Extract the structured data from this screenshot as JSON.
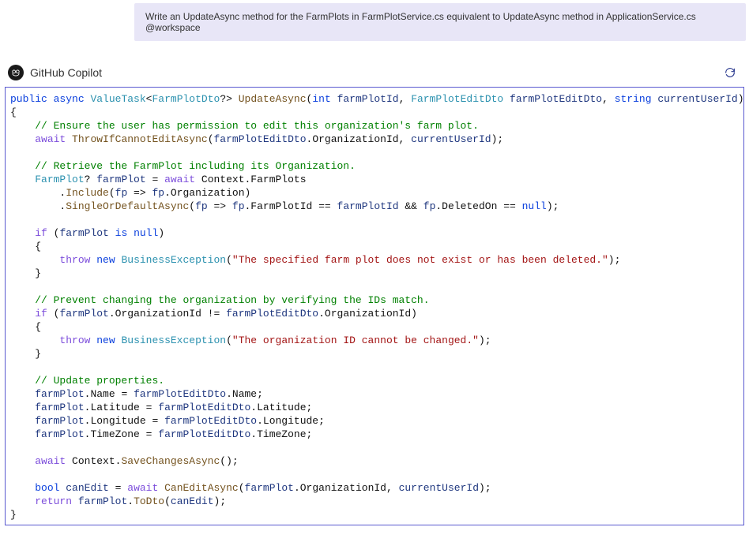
{
  "prompt": {
    "text": "Write an UpdateAsync method for the FarmPlots in FarmPlotService.cs equivalent to UpdateAsync method in ApplicationService.cs @workspace"
  },
  "chat": {
    "sender": "GitHub Copilot"
  },
  "code": {
    "tokens": [
      [
        {
          "t": "public",
          "c": "kw"
        },
        {
          "t": " "
        },
        {
          "t": "async",
          "c": "kw"
        },
        {
          "t": " "
        },
        {
          "t": "ValueTask",
          "c": "type"
        },
        {
          "t": "<"
        },
        {
          "t": "FarmPlotDto",
          "c": "type"
        },
        {
          "t": "?> "
        },
        {
          "t": "UpdateAsync",
          "c": "method"
        },
        {
          "t": "("
        },
        {
          "t": "int",
          "c": "kw"
        },
        {
          "t": " "
        },
        {
          "t": "farmPlotId",
          "c": "param"
        },
        {
          "t": ", "
        },
        {
          "t": "FarmPlotEditDto",
          "c": "type"
        },
        {
          "t": " "
        },
        {
          "t": "farmPlotEditDto",
          "c": "param"
        },
        {
          "t": ", "
        },
        {
          "t": "string",
          "c": "kw"
        },
        {
          "t": " "
        },
        {
          "t": "currentUserId",
          "c": "param"
        },
        {
          "t": ")"
        }
      ],
      [
        {
          "t": "{"
        }
      ],
      [
        {
          "t": "    "
        },
        {
          "t": "// Ensure the user has permission to edit this organization's farm plot.",
          "c": "comment"
        }
      ],
      [
        {
          "t": "    "
        },
        {
          "t": "await",
          "c": "prep"
        },
        {
          "t": " "
        },
        {
          "t": "ThrowIfCannotEditAsync",
          "c": "method"
        },
        {
          "t": "("
        },
        {
          "t": "farmPlotEditDto",
          "c": "local"
        },
        {
          "t": ".OrganizationId, "
        },
        {
          "t": "currentUserId",
          "c": "local"
        },
        {
          "t": ");"
        }
      ],
      [],
      [
        {
          "t": "    "
        },
        {
          "t": "// Retrieve the FarmPlot including its Organization.",
          "c": "comment"
        }
      ],
      [
        {
          "t": "    "
        },
        {
          "t": "FarmPlot",
          "c": "type"
        },
        {
          "t": "? "
        },
        {
          "t": "farmPlot",
          "c": "local"
        },
        {
          "t": " = "
        },
        {
          "t": "await",
          "c": "prep"
        },
        {
          "t": " Context.FarmPlots"
        }
      ],
      [
        {
          "t": "        ."
        },
        {
          "t": "Include",
          "c": "method"
        },
        {
          "t": "("
        },
        {
          "t": "fp",
          "c": "local"
        },
        {
          "t": " => "
        },
        {
          "t": "fp",
          "c": "local"
        },
        {
          "t": ".Organization)"
        }
      ],
      [
        {
          "t": "        ."
        },
        {
          "t": "SingleOrDefaultAsync",
          "c": "method"
        },
        {
          "t": "("
        },
        {
          "t": "fp",
          "c": "local"
        },
        {
          "t": " => "
        },
        {
          "t": "fp",
          "c": "local"
        },
        {
          "t": ".FarmPlotId == "
        },
        {
          "t": "farmPlotId",
          "c": "local"
        },
        {
          "t": " && "
        },
        {
          "t": "fp",
          "c": "local"
        },
        {
          "t": ".DeletedOn == "
        },
        {
          "t": "null",
          "c": "kw"
        },
        {
          "t": ");"
        }
      ],
      [],
      [
        {
          "t": "    "
        },
        {
          "t": "if",
          "c": "prep"
        },
        {
          "t": " ("
        },
        {
          "t": "farmPlot",
          "c": "local"
        },
        {
          "t": " "
        },
        {
          "t": "is",
          "c": "kw"
        },
        {
          "t": " "
        },
        {
          "t": "null",
          "c": "kw"
        },
        {
          "t": ")"
        }
      ],
      [
        {
          "t": "    {"
        }
      ],
      [
        {
          "t": "        "
        },
        {
          "t": "throw",
          "c": "prep"
        },
        {
          "t": " "
        },
        {
          "t": "new",
          "c": "kw"
        },
        {
          "t": " "
        },
        {
          "t": "BusinessException",
          "c": "type"
        },
        {
          "t": "("
        },
        {
          "t": "\"The specified farm plot does not exist or has been deleted.\"",
          "c": "str"
        },
        {
          "t": ");"
        }
      ],
      [
        {
          "t": "    }"
        }
      ],
      [],
      [
        {
          "t": "    "
        },
        {
          "t": "// Prevent changing the organization by verifying the IDs match.",
          "c": "comment"
        }
      ],
      [
        {
          "t": "    "
        },
        {
          "t": "if",
          "c": "prep"
        },
        {
          "t": " ("
        },
        {
          "t": "farmPlot",
          "c": "local"
        },
        {
          "t": ".OrganizationId != "
        },
        {
          "t": "farmPlotEditDto",
          "c": "local"
        },
        {
          "t": ".OrganizationId)"
        }
      ],
      [
        {
          "t": "    {"
        }
      ],
      [
        {
          "t": "        "
        },
        {
          "t": "throw",
          "c": "prep"
        },
        {
          "t": " "
        },
        {
          "t": "new",
          "c": "kw"
        },
        {
          "t": " "
        },
        {
          "t": "BusinessException",
          "c": "type"
        },
        {
          "t": "("
        },
        {
          "t": "\"The organization ID cannot be changed.\"",
          "c": "str"
        },
        {
          "t": ");"
        }
      ],
      [
        {
          "t": "    }"
        }
      ],
      [],
      [
        {
          "t": "    "
        },
        {
          "t": "// Update properties.",
          "c": "comment"
        }
      ],
      [
        {
          "t": "    "
        },
        {
          "t": "farmPlot",
          "c": "local"
        },
        {
          "t": ".Name = "
        },
        {
          "t": "farmPlotEditDto",
          "c": "local"
        },
        {
          "t": ".Name;"
        }
      ],
      [
        {
          "t": "    "
        },
        {
          "t": "farmPlot",
          "c": "local"
        },
        {
          "t": ".Latitude = "
        },
        {
          "t": "farmPlotEditDto",
          "c": "local"
        },
        {
          "t": ".Latitude;"
        }
      ],
      [
        {
          "t": "    "
        },
        {
          "t": "farmPlot",
          "c": "local"
        },
        {
          "t": ".Longitude = "
        },
        {
          "t": "farmPlotEditDto",
          "c": "local"
        },
        {
          "t": ".Longitude;"
        }
      ],
      [
        {
          "t": "    "
        },
        {
          "t": "farmPlot",
          "c": "local"
        },
        {
          "t": ".TimeZone = "
        },
        {
          "t": "farmPlotEditDto",
          "c": "local"
        },
        {
          "t": ".TimeZone;"
        }
      ],
      [],
      [
        {
          "t": "    "
        },
        {
          "t": "await",
          "c": "prep"
        },
        {
          "t": " Context."
        },
        {
          "t": "SaveChangesAsync",
          "c": "method"
        },
        {
          "t": "();"
        }
      ],
      [],
      [
        {
          "t": "    "
        },
        {
          "t": "bool",
          "c": "kw"
        },
        {
          "t": " "
        },
        {
          "t": "canEdit",
          "c": "local"
        },
        {
          "t": " = "
        },
        {
          "t": "await",
          "c": "prep"
        },
        {
          "t": " "
        },
        {
          "t": "CanEditAsync",
          "c": "method"
        },
        {
          "t": "("
        },
        {
          "t": "farmPlot",
          "c": "local"
        },
        {
          "t": ".OrganizationId, "
        },
        {
          "t": "currentUserId",
          "c": "local"
        },
        {
          "t": ");"
        }
      ],
      [
        {
          "t": "    "
        },
        {
          "t": "return",
          "c": "prep"
        },
        {
          "t": " "
        },
        {
          "t": "farmPlot",
          "c": "local"
        },
        {
          "t": "."
        },
        {
          "t": "ToDto",
          "c": "method"
        },
        {
          "t": "("
        },
        {
          "t": "canEdit",
          "c": "local"
        },
        {
          "t": ");"
        }
      ],
      [
        {
          "t": "}"
        }
      ]
    ]
  }
}
